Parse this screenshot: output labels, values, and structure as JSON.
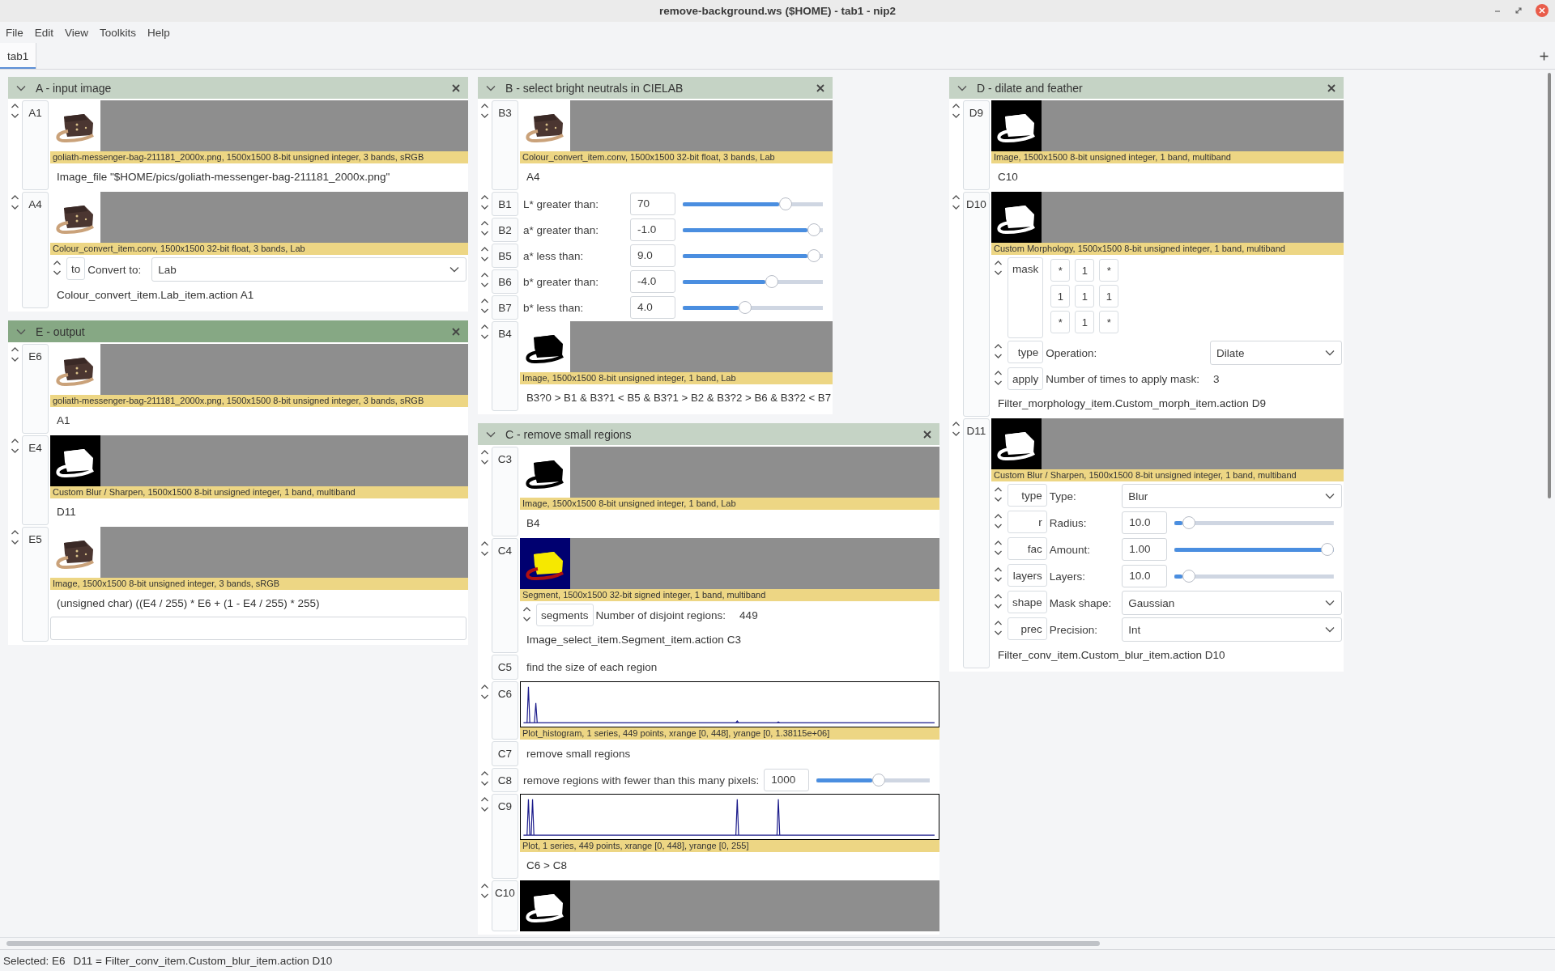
{
  "window": {
    "title": "remove-background.ws ($HOME) - tab1 - nip2"
  },
  "menu": [
    "File",
    "Edit",
    "View",
    "Toolkits",
    "Help"
  ],
  "tabs": [
    {
      "label": "tab1",
      "selected": true
    }
  ],
  "workspace": {
    "stacks": [
      {
        "columns": [
          {
            "title": "A - input image",
            "selected": false,
            "rows": [
              {
                "kind": "photo-image",
                "label": "A1",
                "caption": "goliath-messenger-bag-211181_2000x.png, 1500x1500 8-bit unsigned integer, 3 bands, sRGB",
                "expr": "Image_file \"$HOME/pics/goliath-messenger-bag-211181_2000x.png\""
              },
              {
                "kind": "photo-image",
                "label": "A4",
                "caption": "Colour_convert_item.conv, 1500x1500 32-bit float, 3 bands, Lab",
                "params": [
                  {
                    "kind": "option",
                    "name": "to",
                    "label": "Convert to:",
                    "value": "Lab"
                  }
                ],
                "expr": "Colour_convert_item.Lab_item.action A1"
              }
            ]
          },
          {
            "title": "E - output",
            "selected": true,
            "rows": [
              {
                "kind": "photo-image",
                "label": "E6",
                "caption": "goliath-messenger-bag-211181_2000x.png, 1500x1500 8-bit unsigned integer, 3 bands, sRGB",
                "expr": "A1"
              },
              {
                "kind": "mask-image",
                "label": "E4",
                "caption": "Custom Blur / Sharpen, 1500x1500 8-bit unsigned integer, 1 band, multiband",
                "expr": "D11"
              },
              {
                "kind": "photo-image",
                "label": "E5",
                "caption": "Image, 1500x1500 8-bit unsigned integer, 3 bands, sRGB",
                "expr": "(unsigned char) ((E4 / 255) * E6 + (1 - E4 / 255) * 255)",
                "entry_field": true
              }
            ]
          }
        ]
      },
      {
        "columns": [
          {
            "title": "B - select bright neutrals in CIELAB",
            "selected": false,
            "rows": [
              {
                "kind": "photo-image",
                "label": "B3",
                "caption": "Colour_convert_item.conv, 1500x1500 32-bit float, 3 bands, Lab",
                "expr": "A4"
              },
              {
                "kind": "slider",
                "label": "B1",
                "text": "L* greater than:",
                "value": "70",
                "level": 0.69
              },
              {
                "kind": "slider",
                "label": "B2",
                "text": "a* greater than:",
                "value": "-1.0",
                "level": 0.89
              },
              {
                "kind": "slider",
                "label": "B5",
                "text": "a* less than:",
                "value": "9.0",
                "level": 0.89
              },
              {
                "kind": "slider",
                "label": "B6",
                "text": "b* greater than:",
                "value": "-4.0",
                "level": 0.59
              },
              {
                "kind": "slider",
                "label": "B7",
                "text": "b* less than:",
                "value": "4.0",
                "level": 0.4
              },
              {
                "kind": "silhouette-image",
                "label": "B4",
                "caption": "Image, 1500x1500 8-bit unsigned integer, 1 band, Lab",
                "expr": "B3?0 > B1 & B3?1 < B5 & B3?1 > B2 & B3?2 > B6 & B3?2 < B7"
              }
            ]
          },
          {
            "title": "C - remove small regions",
            "selected": false,
            "rows": [
              {
                "kind": "silhouette-image",
                "label": "C3",
                "caption": "Image, 1500x1500 8-bit unsigned integer, 1 band, Lab",
                "expr": "B4"
              },
              {
                "kind": "segment-image",
                "label": "C4",
                "caption": "Segment, 1500x1500 32-bit signed integer, 1 band, multiband",
                "params": [
                  {
                    "kind": "value",
                    "name": "segments",
                    "label": "Number of disjoint regions:",
                    "value": "449"
                  }
                ],
                "expr": "Image_select_item.Segment_item.action C3"
              },
              {
                "kind": "comment",
                "label": "C5",
                "text": "find the size of each region"
              },
              {
                "kind": "plot",
                "label": "C6",
                "caption": "Plot_histogram, 1 series, 449 points, xrange [0, 448], yrange [0, 1.38115e+06]"
              },
              {
                "kind": "comment",
                "label": "C7",
                "text": "remove small regions"
              },
              {
                "kind": "slider",
                "label": "C8",
                "text": "remove regions with fewer than this many pixels:",
                "value": "1000",
                "level": 0.49
              },
              {
                "kind": "plot",
                "label": "C9",
                "caption": "Plot, 1 series, 449 points, xrange [0, 448], yrange [0, 255]",
                "expr": "C6 > C8"
              },
              {
                "kind": "mask-image",
                "label": "C10"
              }
            ]
          }
        ]
      },
      {
        "columns": [
          {
            "title": "D - dilate and feather",
            "selected": false,
            "rows": [
              {
                "kind": "mask-image",
                "label": "D9",
                "caption": "Image, 1500x1500 8-bit unsigned integer, 1 band, multiband",
                "expr": "C10"
              },
              {
                "kind": "mask-image",
                "label": "D10",
                "caption": "Custom Morphology, 1500x1500 8-bit unsigned integer, 1 band, multiband",
                "params": [
                  {
                    "kind": "matrix",
                    "name": "mask",
                    "cells": [
                      [
                        "*",
                        "1",
                        "*"
                      ],
                      [
                        "1",
                        "1",
                        "1"
                      ],
                      [
                        "*",
                        "1",
                        "*"
                      ]
                    ]
                  },
                  {
                    "kind": "option",
                    "name": "type",
                    "label": "Operation:",
                    "value": "Dilate"
                  },
                  {
                    "kind": "value",
                    "name": "apply",
                    "label": "Number of times to apply mask:",
                    "value": "3"
                  }
                ],
                "expr": "Filter_morphology_item.Custom_morph_item.action D9"
              },
              {
                "kind": "mask-image",
                "label": "D11",
                "caption": "Custom Blur / Sharpen, 1500x1500 8-bit unsigned integer, 1 band, multiband",
                "params": [
                  {
                    "kind": "option",
                    "name": "type",
                    "label": "Type:",
                    "value": "Blur"
                  },
                  {
                    "kind": "slider",
                    "name": "r",
                    "label": "Radius:",
                    "value": "10.0",
                    "level": 0.05
                  },
                  {
                    "kind": "slider",
                    "name": "fac",
                    "label": "Amount:",
                    "value": "1.00",
                    "level": 1.0
                  },
                  {
                    "kind": "slider",
                    "name": "layers",
                    "label": "Layers:",
                    "value": "10.0",
                    "level": 0.05
                  },
                  {
                    "kind": "option",
                    "name": "shape",
                    "label": "Mask shape:",
                    "value": "Gaussian"
                  },
                  {
                    "kind": "option",
                    "name": "prec",
                    "label": "Precision:",
                    "value": "Int"
                  }
                ],
                "expr": "Filter_conv_item.Custom_blur_item.action D10"
              }
            ]
          }
        ]
      }
    ]
  },
  "status": {
    "selection": "Selected: E6",
    "message": "D11 = Filter_conv_item.Custom_blur_item.action D10"
  }
}
